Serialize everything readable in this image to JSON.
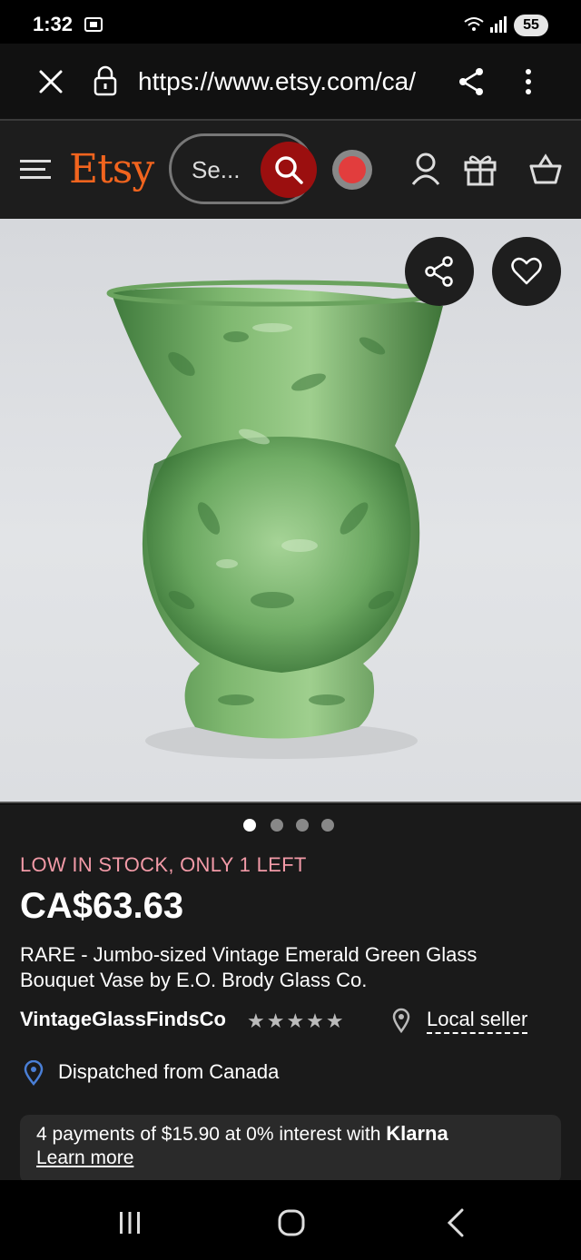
{
  "status_bar": {
    "time": "1:32",
    "battery": "55"
  },
  "url_bar": {
    "url": "https://www.etsy.com/ca/"
  },
  "header": {
    "logo": "Etsy",
    "search_placeholder": "Se..."
  },
  "product": {
    "image_dots": {
      "count": 4,
      "active_index": 0
    },
    "stock_notice": "LOW IN STOCK, ONLY 1 LEFT",
    "price": "CA$63.63",
    "title": "RARE - Jumbo-sized Vintage Emerald Green Glass Bouquet Vase by E.O. Brody Glass Co.",
    "seller": "VintageGlassFindsCo",
    "stars": "★★★★★",
    "rating": 5,
    "local_seller": "Local seller",
    "dispatched_from": "Dispatched from Canada",
    "klarna": {
      "text": "4 payments of $15.90 at 0% interest with",
      "brand": "Klarna",
      "learn_more": "Learn more"
    }
  },
  "colors": {
    "etsy_orange": "#f1641e",
    "search_button": "#9b0f0f",
    "stock_pink": "#f29aa7",
    "pin_blue": "#4a7fd6"
  }
}
